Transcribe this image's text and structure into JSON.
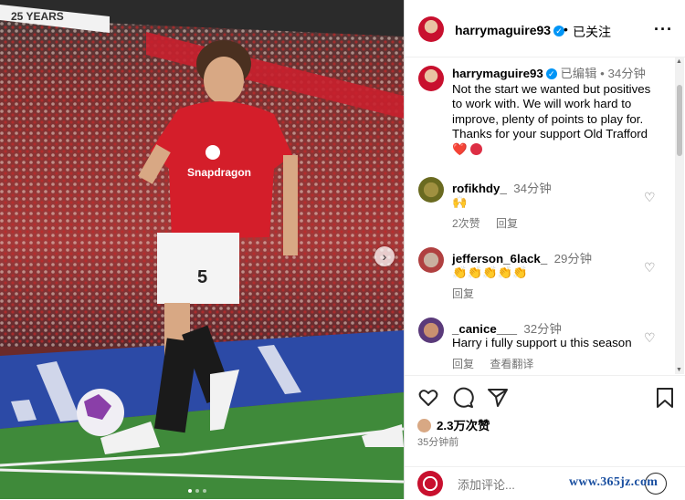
{
  "photo": {
    "banner_text": "25 YEARS",
    "shirt_text": "Snapdragon",
    "shirt_number": "5"
  },
  "header": {
    "username": "harrymaguire93",
    "separator": "•",
    "follow_status": "已关注",
    "more_icon": "more-horizontal-icon"
  },
  "caption": {
    "username": "harrymaguire93",
    "edited": "已编辑",
    "dot": "•",
    "time": "34分钟",
    "text": "Not the start we wanted but positives to work with. We will work hard to improve, plenty of points to play for. Thanks for your support Old Trafford ❤️"
  },
  "comments": [
    {
      "username": "rofikhdy_",
      "time": "34分钟",
      "body": "🙌",
      "likes": "2次赞",
      "reply": "回复"
    },
    {
      "username": "jefferson_6lack_",
      "time": "29分钟",
      "body": "👏👏👏👏👏",
      "reply": "回复"
    },
    {
      "username": "_canice___",
      "time": "32分钟",
      "body": "Harry i fully support u this season",
      "reply": "回复",
      "translate": "查看翻译"
    }
  ],
  "actions": {
    "likes_count": "2.3万次赞",
    "posted": "35分钟前"
  },
  "add_comment": {
    "placeholder": "添加评论..."
  },
  "watermark": "www.365jz.com",
  "colors": {
    "verified": "#0095f6",
    "shirt_red": "#d41e2a",
    "link_blue": "#1a4fa0"
  }
}
